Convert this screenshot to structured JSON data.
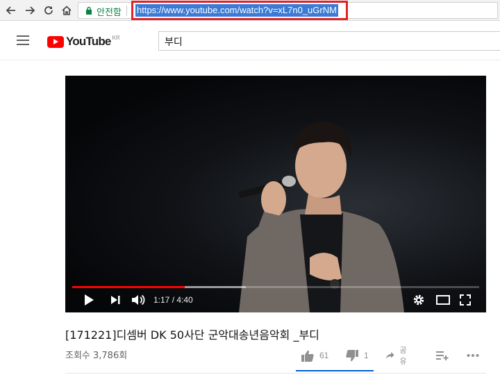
{
  "browser": {
    "back_icon": "arrow-left-icon",
    "forward_icon": "arrow-right-icon",
    "reload_icon": "reload-icon",
    "home_icon": "home-icon",
    "secure_label": "안전함",
    "url": "https://www.youtube.com/watch?v=xL7n0_uGrNM",
    "highlight_color": "#e0232a"
  },
  "header": {
    "logo_text": "YouTube",
    "logo_region": "KR",
    "search_value": "부디",
    "brand_color": "#ff0000"
  },
  "player": {
    "progress_fraction": 0.277,
    "buffered_fraction": 0.426,
    "time_display": "1:17 / 4:40",
    "controls": [
      "play-icon",
      "next-icon",
      "volume-icon",
      "settings-icon",
      "theater-mode-icon",
      "fullscreen-icon"
    ]
  },
  "video": {
    "title": "[171221]디셈버 DK 50사단 군악대송년음악회 _부디",
    "views": "조회수 3,786회",
    "likes": "61",
    "dislikes": "1",
    "share_label": "공유",
    "accent_color": "#065fd4"
  }
}
